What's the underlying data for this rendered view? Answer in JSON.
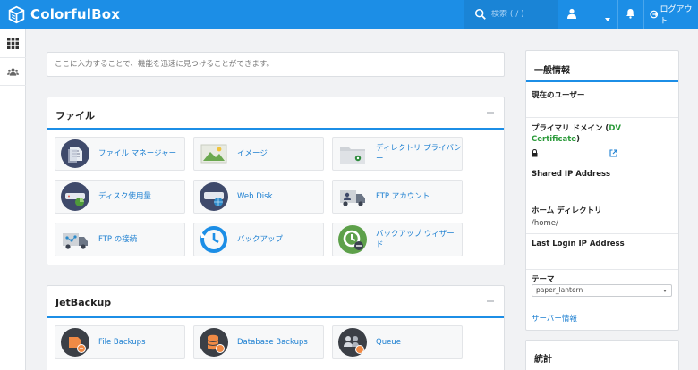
{
  "app": {
    "brand": "ColorfulBox",
    "accent": "#1c8ee6"
  },
  "topbar": {
    "search_placeholder": "検索 ( / )",
    "user_icon": "user-icon",
    "bell_icon": "bell-icon",
    "logout_label": "ログアウト"
  },
  "sidebar": {
    "items": [
      {
        "icon": "grid-icon"
      },
      {
        "icon": "users-icon"
      }
    ]
  },
  "quick_search": {
    "placeholder": "ここに入力することで、機能を迅速に見つけることができます。"
  },
  "files": {
    "title": "ファイル",
    "items": [
      {
        "label": "ファイル マネージャー",
        "icon": "file-manager-icon"
      },
      {
        "label": "イメージ",
        "icon": "images-icon"
      },
      {
        "label": "ディレクトリ プライバシー",
        "icon": "directory-privacy-icon"
      },
      {
        "label": "ディスク使用量",
        "icon": "disk-usage-icon"
      },
      {
        "label": "Web Disk",
        "icon": "web-disk-icon"
      },
      {
        "label": "FTP アカウント",
        "icon": "ftp-accounts-icon"
      },
      {
        "label": "FTP の接続",
        "icon": "ftp-connections-icon"
      },
      {
        "label": "バックアップ",
        "icon": "backup-icon"
      },
      {
        "label": "バックアップ ウィザード",
        "icon": "backup-wizard-icon"
      }
    ]
  },
  "jetbackup": {
    "title": "JetBackup",
    "items": [
      {
        "label": "File Backups",
        "icon": "file-backups-icon"
      },
      {
        "label": "Database Backups",
        "icon": "database-backups-icon"
      },
      {
        "label": "Queue",
        "icon": "queue-icon"
      }
    ]
  },
  "general_info": {
    "title": "一般情報",
    "current_user_label": "現在のユーザー",
    "current_user_value": "",
    "primary_domain_label": "プライマリ ドメイン (",
    "primary_domain_dv": "DV Certificate",
    "primary_domain_close": ")",
    "shared_ip_label": "Shared IP Address",
    "shared_ip_value": "",
    "home_dir_label": "ホーム ディレクトリ",
    "home_dir_value": "/home/",
    "last_login_label": "Last Login IP Address",
    "last_login_value": "",
    "theme_label": "テーマ",
    "theme_value": "paper_lantern",
    "server_info_link": "サーバー情報"
  },
  "stats": {
    "title": "統計"
  }
}
